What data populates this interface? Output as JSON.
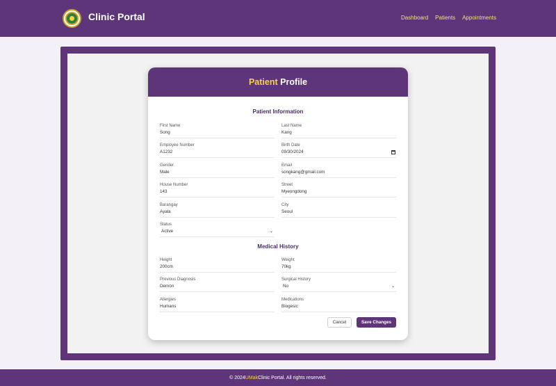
{
  "header": {
    "brand": "Clinic Portal",
    "nav": [
      "Dashboard",
      "Patients",
      "Appointments"
    ]
  },
  "card": {
    "title_highlight": "Patient",
    "title_rest": " Profile",
    "sections": {
      "patient_info": "Patient Information",
      "medical_history": "Medical History"
    },
    "fields": {
      "first_name": {
        "label": "First Name",
        "value": "Song"
      },
      "last_name": {
        "label": "Last Name",
        "value": "Kang"
      },
      "employee_number": {
        "label": "Employee Number",
        "value": "A1232"
      },
      "birth_date": {
        "label": "Birth Date",
        "value": "09/30/2024"
      },
      "gender": {
        "label": "Gender",
        "value": "Male"
      },
      "email": {
        "label": "Email",
        "value": "songkang@gmail.com"
      },
      "house_number": {
        "label": "House Number",
        "value": "143"
      },
      "street": {
        "label": "Street",
        "value": "Myeongdong"
      },
      "barangay": {
        "label": "Barangay",
        "value": "Ayala"
      },
      "city": {
        "label": "City",
        "value": "Seoul"
      },
      "status": {
        "label": "Status",
        "value": "Active"
      },
      "height": {
        "label": "Height",
        "value": "200cm"
      },
      "weight": {
        "label": "Weight",
        "value": "70kg"
      },
      "previous_diagnosis": {
        "label": "Previous Diagnosis",
        "value": "Demon"
      },
      "surgical_history": {
        "label": "Surgical History",
        "value": "No"
      },
      "allergies": {
        "label": "Allergies",
        "value": "Humans"
      },
      "medications": {
        "label": "Medications",
        "value": "Biogesic"
      }
    },
    "buttons": {
      "cancel": "Cancel",
      "save": "Save Changes"
    }
  },
  "footer": {
    "prefix": "© 2024 ",
    "brand": "UMak",
    "suffix": " Clinic Portal. All rights reserved."
  },
  "colors": {
    "primary": "#5e3579",
    "accent": "#f5d442"
  },
  "icons": [
    "clinic-logo-icon",
    "calendar-icon",
    "chevron-down-icon"
  ]
}
